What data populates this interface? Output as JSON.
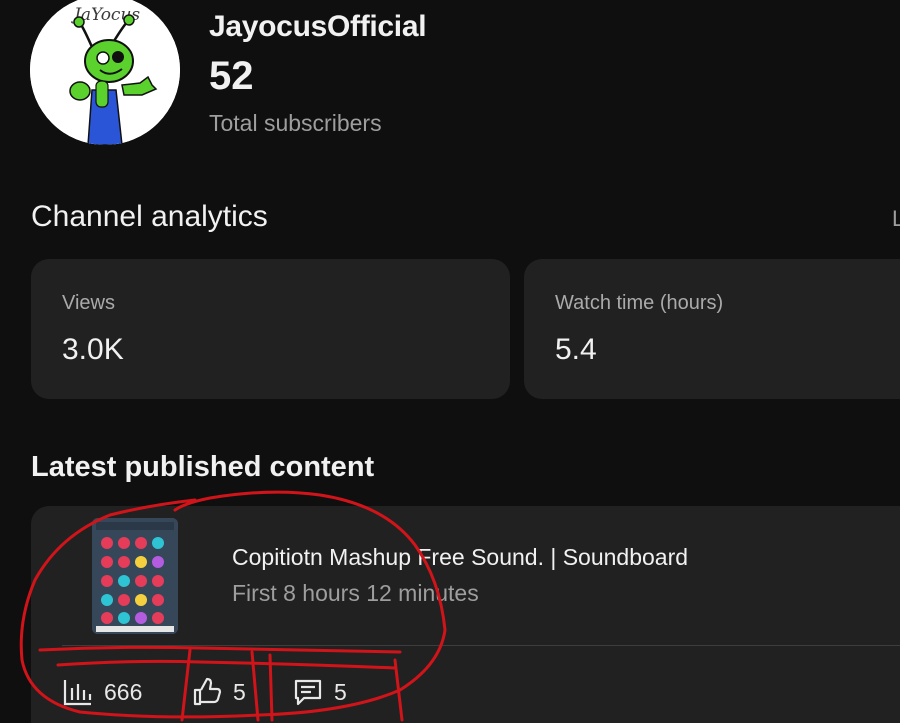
{
  "header": {
    "channel_name": "JayocusOfficial",
    "subscriber_count": "52",
    "subscriber_label": "Total subscribers",
    "avatar_text": "JaYocus"
  },
  "analytics": {
    "title": "Channel analytics",
    "see_more_label": "L",
    "cards": [
      {
        "label": "Views",
        "value": "3.0K"
      },
      {
        "label": "Watch time (hours)",
        "value": "5.4"
      }
    ]
  },
  "latest": {
    "title": "Latest published content",
    "video": {
      "title": "Copitiotn Mashup Free Sound. | Soundboard",
      "subtitle": "First 8 hours 12 minutes",
      "views": "666",
      "likes": "5",
      "comments": "5"
    }
  },
  "colors": {
    "background": "#0f0f0f",
    "card": "#212121",
    "annotation": "#d0141a"
  }
}
